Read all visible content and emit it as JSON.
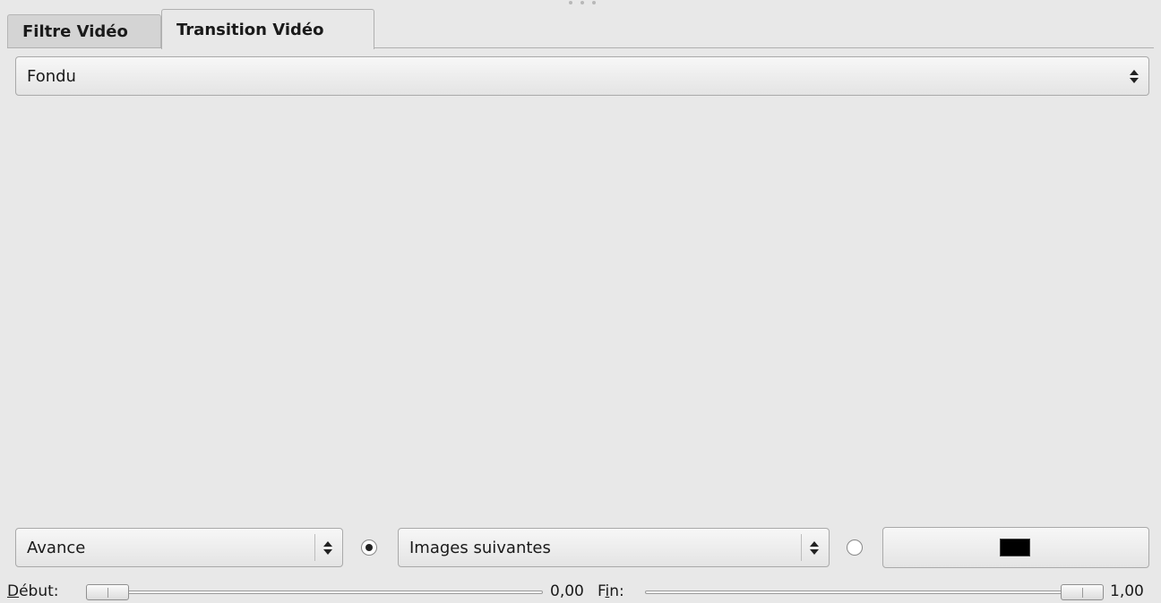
{
  "tabs": [
    {
      "label": "Filtre Vidéo",
      "active": false
    },
    {
      "label": "Transition Vidéo",
      "active": true
    }
  ],
  "transition_combo": {
    "value": "Fondu"
  },
  "direction_combo": {
    "value": "Avance"
  },
  "source_combo": {
    "value": "Images suivantes"
  },
  "radios": {
    "images_checked": true,
    "color_checked": false
  },
  "color_button": {
    "color": "#000000"
  },
  "start": {
    "label_prefix": "D",
    "label_rest": "ébut:",
    "value": "0,00",
    "position": 0.0
  },
  "end": {
    "label_prefix": "F",
    "label_mnemonic": "i",
    "label_rest": "n:",
    "value": "1,00",
    "position": 1.0
  }
}
